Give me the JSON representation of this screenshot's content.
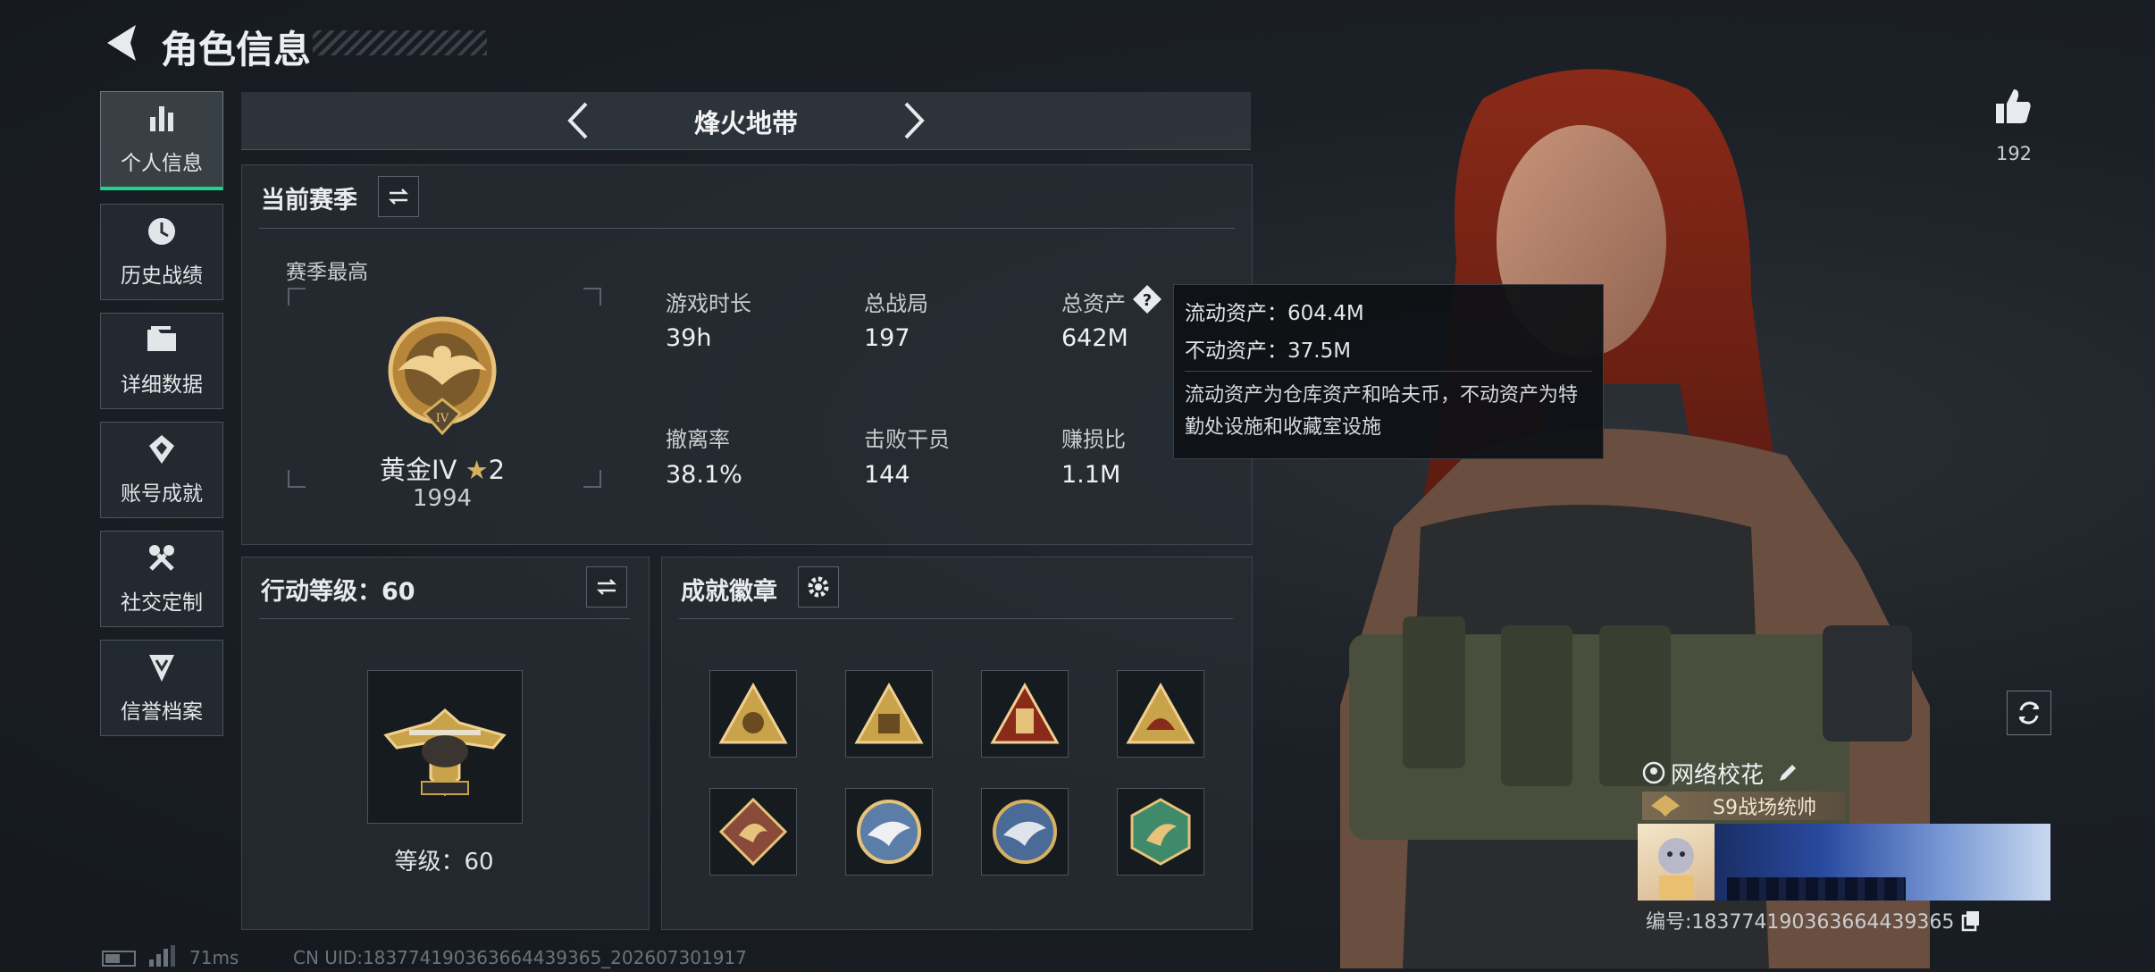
{
  "header": {
    "title": "角色信息"
  },
  "sidebar": {
    "items": [
      {
        "label": "个人信息",
        "icon": "bar-chart-icon",
        "active": true
      },
      {
        "label": "历史战绩",
        "icon": "clock-icon"
      },
      {
        "label": "详细数据",
        "icon": "folder-icon"
      },
      {
        "label": "账号成就",
        "icon": "achievement-icon"
      },
      {
        "label": "社交定制",
        "icon": "wrench-icon"
      },
      {
        "label": "信誉档案",
        "icon": "shield-icon"
      }
    ]
  },
  "mode_selector": {
    "label": "烽火地带"
  },
  "season": {
    "title": "当前赛季",
    "best_label": "赛季最高",
    "rank_name": "黄金IV",
    "rank_stars": "2",
    "rank_score": "1994",
    "stats": [
      {
        "label": "游戏时长",
        "value": "39h"
      },
      {
        "label": "总战局",
        "value": "197"
      },
      {
        "label": "总资产",
        "value": "642M"
      },
      {
        "label": "撤离率",
        "value": "38.1%"
      },
      {
        "label": "击败干员",
        "value": "144"
      },
      {
        "label": "赚损比",
        "value": "1.1M"
      }
    ]
  },
  "tooltip": {
    "liquid": "流动资产：604.4M",
    "fixed": "不动资产：37.5M",
    "desc": "流动资产为仓库资产和哈夫币，不动资产为特勤处设施和收藏室设施"
  },
  "action_level": {
    "title": "行动等级：60",
    "level_text": "等级：60"
  },
  "achievements": {
    "title": "成就徽章",
    "badges": [
      {
        "icon": "triangle-badge-icon",
        "color": "#c9a34a"
      },
      {
        "icon": "triangle-badge-icon",
        "color": "#c9a34a"
      },
      {
        "icon": "triangle-badge-icon",
        "color": "#c9a34a"
      },
      {
        "icon": "triangle-badge-icon",
        "color": "#c9a34a"
      },
      {
        "icon": "dragon-badge-icon",
        "color": "#8a4a3a"
      },
      {
        "icon": "eagle-badge-icon",
        "color": "#5a7ea8"
      },
      {
        "icon": "eagle-badge-icon",
        "color": "#4a6a98"
      },
      {
        "icon": "hexagon-badge-icon",
        "color": "#3f8a6a"
      }
    ]
  },
  "likes": {
    "count": "192"
  },
  "profile": {
    "name": "网络校花",
    "title": "S9战场统帅",
    "id_text": "编号:183774190363664439365"
  },
  "footer": {
    "ping": "71ms",
    "uid": "CN UID:183774190363664439365_202607301917"
  },
  "colors": {
    "accent": "#19d68c",
    "gold": "#d4b060"
  }
}
